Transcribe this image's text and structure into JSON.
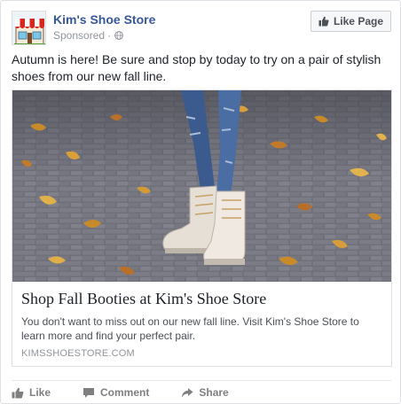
{
  "post": {
    "page_name": "Kim's Shoe Store",
    "sponsored_label": "Sponsored",
    "separator": "·",
    "like_page_label": "Like Page",
    "message": "Autumn is here! Be sure and stop by today to try on a pair of stylish shoes from our new fall line."
  },
  "attachment": {
    "title": "Shop Fall Booties at Kim's Shoe Store",
    "description": "You don't want to miss out on our new fall line. Visit Kim's Shoe Store to learn more and find your perfect pair.",
    "domain": "KIMSSHOESTORE.COM"
  },
  "actions": [
    {
      "label": "Like",
      "icon": "thumbs-up-icon"
    },
    {
      "label": "Comment",
      "icon": "comment-icon"
    },
    {
      "label": "Share",
      "icon": "share-icon"
    }
  ],
  "colors": {
    "link_blue": "#365899",
    "secondary_text": "#90949c",
    "border": "#dddfe2",
    "action_gray": "#7f7f7f"
  }
}
